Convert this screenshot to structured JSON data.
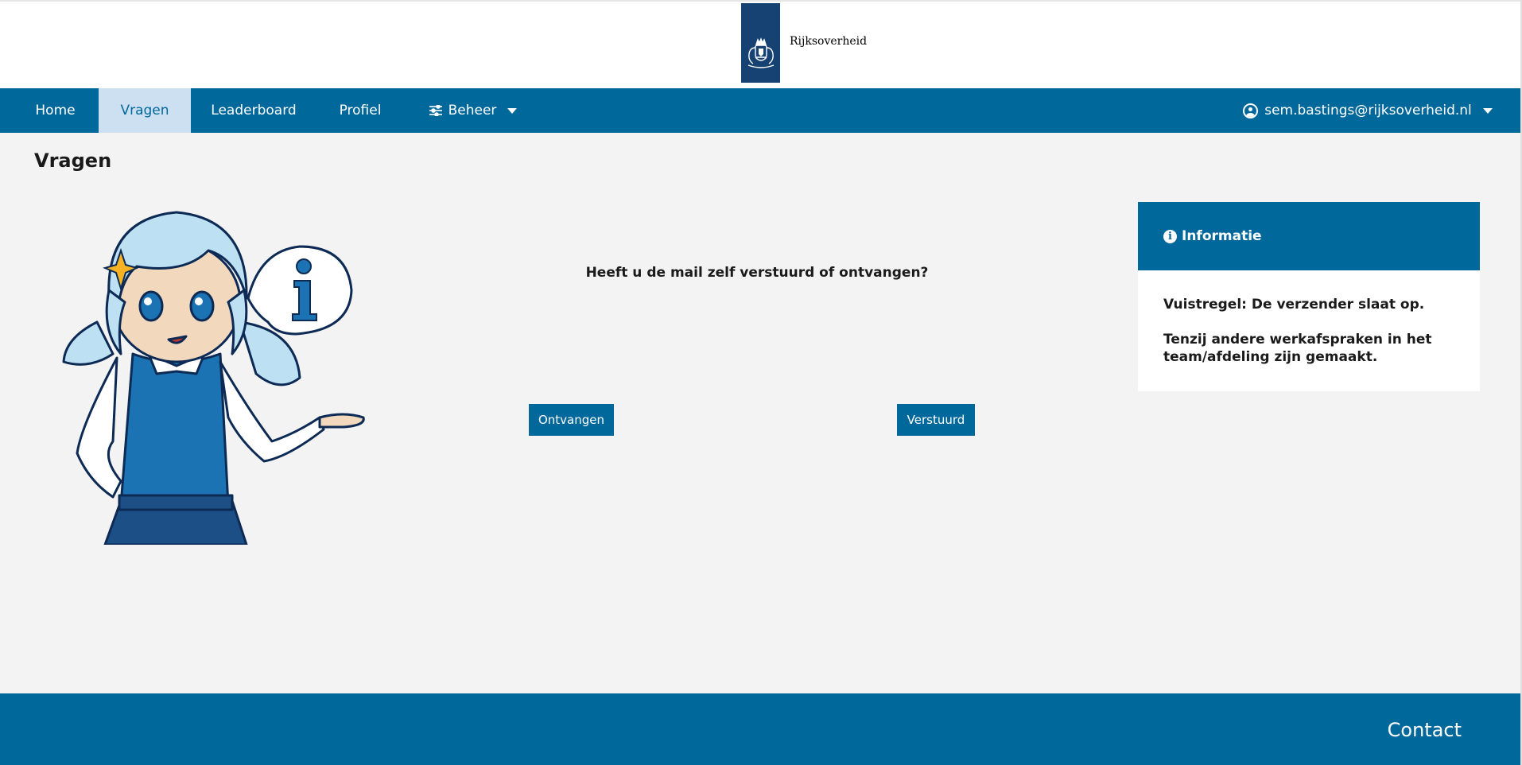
{
  "header": {
    "logo_text": "Rijksoverheid"
  },
  "nav": {
    "home": "Home",
    "vragen": "Vragen",
    "leaderboard": "Leaderboard",
    "profiel": "Profiel",
    "beheer": "Beheer",
    "user_email": "sem.bastings@rijksoverheid.nl",
    "active_item": "Vragen"
  },
  "page": {
    "title": "Vragen"
  },
  "question": {
    "text": "Heeft u de mail zelf verstuurd of ontvangen?",
    "options": [
      "Ontvangen",
      "Verstuurd"
    ]
  },
  "info": {
    "title": "Informatie",
    "lines": [
      "Vuistregel: De verzender slaat op.",
      "Tenzij andere werkafspraken in het team/afdeling zijn gemaakt."
    ]
  },
  "footer": {
    "contact": "Contact"
  },
  "colors": {
    "primary": "#01689b",
    "active_nav_bg": "#cce0f1",
    "logo_ribbon": "#154273",
    "page_bg": "#f3f3f3"
  },
  "icons": [
    "crest-icon",
    "sliders-icon",
    "user-circle-icon",
    "info-icon",
    "chevron-down-icon"
  ]
}
